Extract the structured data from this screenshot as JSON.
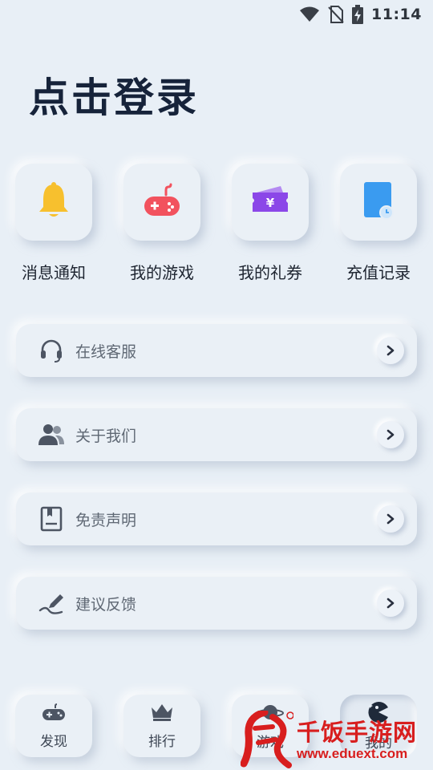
{
  "status_bar": {
    "time": "11:14",
    "icons": [
      "wifi-icon",
      "no-sim-icon",
      "battery-charging-icon"
    ]
  },
  "header": {
    "title": "点击登录"
  },
  "quick_actions": [
    {
      "label": "消息通知",
      "icon": "bell-icon",
      "color": "#f7c02e"
    },
    {
      "label": "我的游戏",
      "icon": "gamepad-icon",
      "color": "#f2525e"
    },
    {
      "label": "我的礼券",
      "icon": "ticket-icon",
      "color": "#8b47e8"
    },
    {
      "label": "充值记录",
      "icon": "record-icon",
      "color": "#3a9bf0"
    }
  ],
  "menu": [
    {
      "label": "在线客服",
      "icon": "headset-icon"
    },
    {
      "label": "关于我们",
      "icon": "users-icon"
    },
    {
      "label": "免责声明",
      "icon": "document-icon"
    },
    {
      "label": "建议反馈",
      "icon": "pen-icon"
    }
  ],
  "bottom_nav": [
    {
      "label": "发现",
      "icon": "gamepad-outline-icon",
      "active": false
    },
    {
      "label": "排行",
      "icon": "crown-icon",
      "active": false
    },
    {
      "label": "游戏",
      "icon": "planet-icon",
      "active": false
    },
    {
      "label": "我的",
      "icon": "pacman-icon",
      "active": true
    }
  ],
  "watermark": {
    "brand": "千饭手游网",
    "url": "www.eduext.com"
  },
  "colors": {
    "background": "#e8eff6",
    "title": "#16233a",
    "watermark": "#d81e1e"
  }
}
